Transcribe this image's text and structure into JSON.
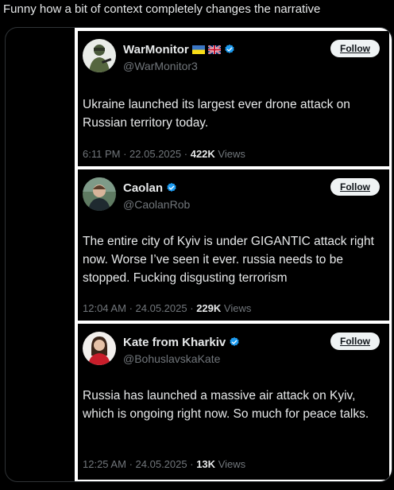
{
  "caption": "Funny how a bit of context completely changes the narrative",
  "colors": {
    "verified": "#1d9bf0",
    "background": "#000000",
    "muted": "#71767b"
  },
  "tweets": [
    {
      "name": "WarMonitor",
      "flags": [
        "ukraine-flag-icon",
        "uk-flag-icon"
      ],
      "handle": "@WarMonitor3",
      "follow": "Follow",
      "text": "Ukraine launched its largest ever drone attack on Russian territory today.",
      "time": "6:11 PM",
      "date": "22.05.2025",
      "views_count": "422K",
      "views_label": "Views",
      "sep": "·"
    },
    {
      "name": "Caolan",
      "handle": "@CaolanRob",
      "follow": "Follow",
      "text": "The entire city of Kyiv is under GIGANTIC attack right now. Worse I’ve seen it ever. russia needs to be stopped. Fucking disgusting terrorism",
      "time": "12:04 AM",
      "date": "24.05.2025",
      "views_count": "229K",
      "views_label": "Views",
      "sep": "·"
    },
    {
      "name": "Kate from Kharkiv",
      "handle": "@BohuslavskaKate",
      "follow": "Follow",
      "text": "Russia has launched a massive air attack on Kyiv, which is ongoing right now. So much for peace talks.",
      "time": "12:25 AM",
      "date": "24.05.2025",
      "views_count": "13K",
      "views_label": "Views",
      "sep": "·"
    }
  ]
}
